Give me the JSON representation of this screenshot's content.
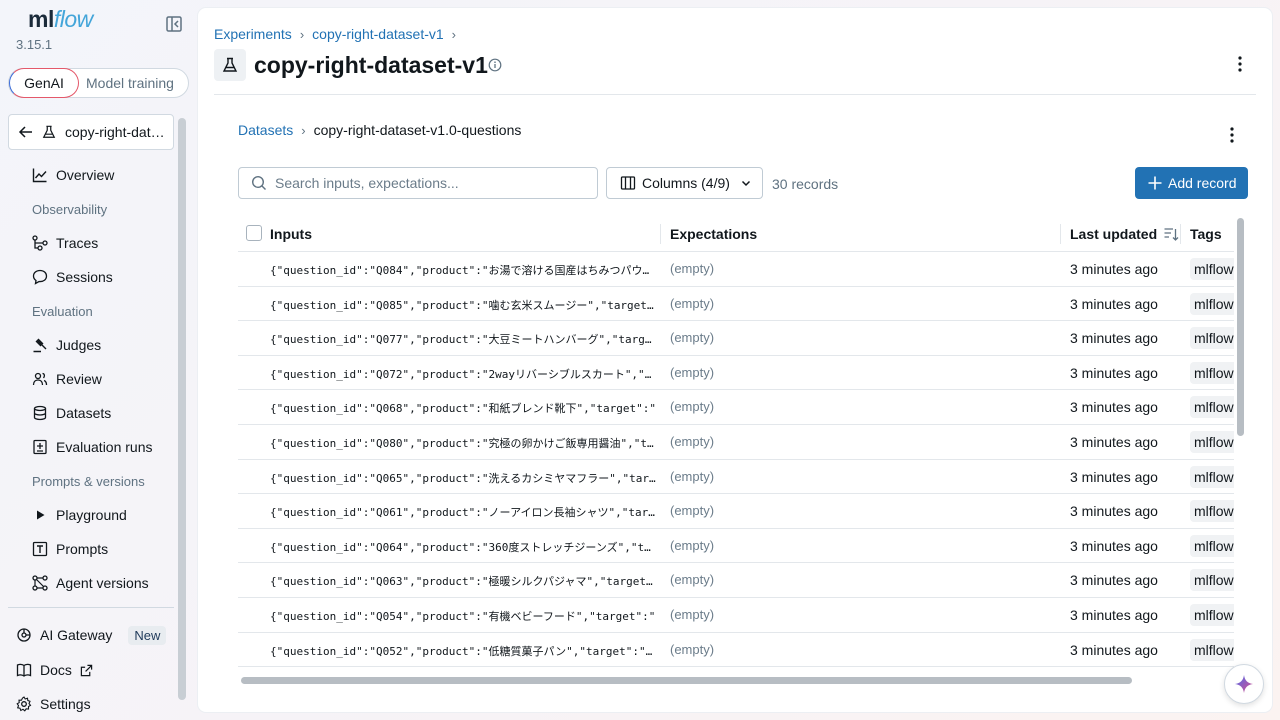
{
  "app": {
    "logo_ml": "ml",
    "logo_flow": "flow",
    "version": "3.15.1"
  },
  "mode_toggle": {
    "genai": "GenAI",
    "model_training": "Model training"
  },
  "sidebar": {
    "experiment_chip": "copy-right-dataset-v1",
    "items": {
      "overview": "Overview",
      "observability": "Observability",
      "traces": "Traces",
      "sessions": "Sessions",
      "evaluation": "Evaluation",
      "judges": "Judges",
      "review": "Review",
      "datasets": "Datasets",
      "evaluation_runs": "Evaluation runs",
      "prompts_versions": "Prompts & versions",
      "playground": "Playground",
      "prompts": "Prompts",
      "agent_versions": "Agent versions"
    },
    "bottom": {
      "ai_gateway": "AI Gateway",
      "new_badge": "New",
      "docs": "Docs",
      "settings": "Settings"
    }
  },
  "header": {
    "breadcrumb_experiments": "Experiments",
    "breadcrumb_experiment": "copy-right-dataset-v1",
    "title": "copy-right-dataset-v1"
  },
  "dataset": {
    "breadcrumb_datasets": "Datasets",
    "breadcrumb_current": "copy-right-dataset-v1.0-questions",
    "search_placeholder": "Search inputs, expectations...",
    "columns_label": "Columns (4/9)",
    "records_count": "30 records",
    "add_record": "Add record"
  },
  "table": {
    "columns": {
      "inputs": "Inputs",
      "expectations": "Expectations",
      "last_updated": "Last updated",
      "tags": "Tags"
    },
    "rows": [
      {
        "input": "{\"question_id\":\"Q084\",\"product\":\"お湯で溶ける国産はちみつパウダー\",\"target\":\"",
        "expectations": "(empty)",
        "updated": "3 minutes ago",
        "tag": "mlflow"
      },
      {
        "input": "{\"question_id\":\"Q085\",\"product\":\"噛む玄米スムージー\",\"target\":\"",
        "expectations": "(empty)",
        "updated": "3 minutes ago",
        "tag": "mlflow"
      },
      {
        "input": "{\"question_id\":\"Q077\",\"product\":\"大豆ミートハンバーグ\",\"target\":\"",
        "expectations": "(empty)",
        "updated": "3 minutes ago",
        "tag": "mlflow"
      },
      {
        "input": "{\"question_id\":\"Q072\",\"product\":\"2wayリバーシブルスカート\",\"target\":\"",
        "expectations": "(empty)",
        "updated": "3 minutes ago",
        "tag": "mlflow"
      },
      {
        "input": "{\"question_id\":\"Q068\",\"product\":\"和紙ブレンド靴下\",\"target\":\"",
        "expectations": "(empty)",
        "updated": "3 minutes ago",
        "tag": "mlflow"
      },
      {
        "input": "{\"question_id\":\"Q080\",\"product\":\"究極の卵かけご飯専用醤油\",\"target\":\"",
        "expectations": "(empty)",
        "updated": "3 minutes ago",
        "tag": "mlflow"
      },
      {
        "input": "{\"question_id\":\"Q065\",\"product\":\"洗えるカシミヤマフラー\",\"target\":\"",
        "expectations": "(empty)",
        "updated": "3 minutes ago",
        "tag": "mlflow"
      },
      {
        "input": "{\"question_id\":\"Q061\",\"product\":\"ノーアイロン長袖シャツ\",\"target\":\"",
        "expectations": "(empty)",
        "updated": "3 minutes ago",
        "tag": "mlflow"
      },
      {
        "input": "{\"question_id\":\"Q064\",\"product\":\"360度ストレッチジーンズ\",\"target\":\"",
        "expectations": "(empty)",
        "updated": "3 minutes ago",
        "tag": "mlflow"
      },
      {
        "input": "{\"question_id\":\"Q063\",\"product\":\"極暖シルクパジャマ\",\"target\":\"",
        "expectations": "(empty)",
        "updated": "3 minutes ago",
        "tag": "mlflow"
      },
      {
        "input": "{\"question_id\":\"Q054\",\"product\":\"有機ベビーフード\",\"target\":\"",
        "expectations": "(empty)",
        "updated": "3 minutes ago",
        "tag": "mlflow"
      },
      {
        "input": "{\"question_id\":\"Q052\",\"product\":\"低糖質菓子パン\",\"target\":\"糖",
        "expectations": "(empty)",
        "updated": "3 minutes ago",
        "tag": "mlflow"
      }
    ]
  },
  "colors": {
    "primary": "#2272b4",
    "text": "#11171c",
    "muted": "#5f7281"
  }
}
